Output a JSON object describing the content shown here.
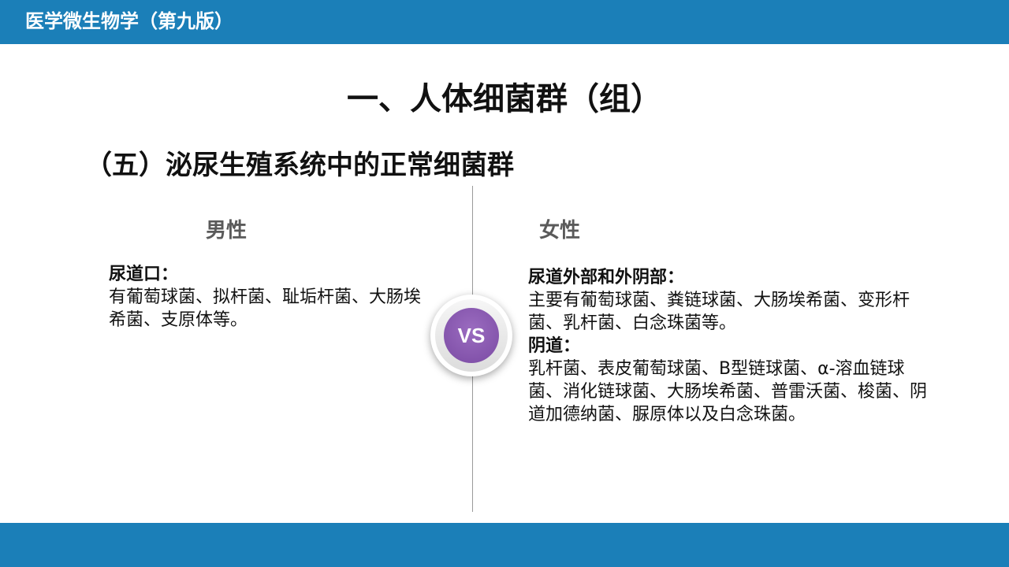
{
  "header": {
    "book_title": "医学微生物学（第九版）"
  },
  "slide": {
    "title": "一、人体细菌群（组）",
    "subtitle": "（五）泌尿生殖系统中的正常细菌群"
  },
  "comparison": {
    "vs_label": "VS",
    "male": {
      "heading": "男性",
      "sections": [
        {
          "label": "尿道口：",
          "text": "有葡萄球菌、拟杆菌、耻垢杆菌、大肠埃希菌、支原体等。"
        }
      ]
    },
    "female": {
      "heading": "女性",
      "sections": [
        {
          "label": "尿道外部和外阴部：",
          "text": "主要有葡萄球菌、粪链球菌、大肠埃希菌、变形杆菌、乳杆菌、白念珠菌等。"
        },
        {
          "label": "阴道：",
          "text": "乳杆菌、表皮葡萄球菌、B型链球菌、α-溶血链球菌、消化链球菌、大肠埃希菌、普雷沃菌、梭菌、阴道加德纳菌、脲原体以及白念珠菌。"
        }
      ]
    }
  },
  "colors": {
    "header_bar": "#1b7fb8",
    "footer_bar": "#1b7fb8",
    "vs_badge": "#8a5bb3"
  }
}
